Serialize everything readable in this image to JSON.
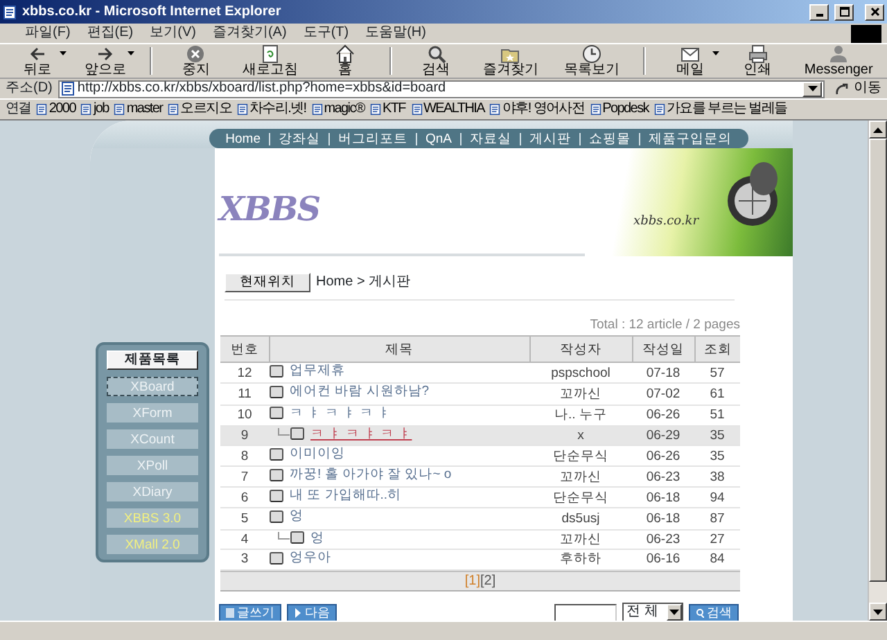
{
  "window": {
    "title": "xbbs.co.kr - Microsoft Internet Explorer"
  },
  "menu_bar": [
    "파일(F)",
    "편집(E)",
    "보기(V)",
    "즐겨찾기(A)",
    "도구(T)",
    "도움말(H)"
  ],
  "toolbar": [
    {
      "kind": "back",
      "label": "뒤로",
      "dropdown": true
    },
    {
      "kind": "forward",
      "label": "앞으로",
      "dropdown": true
    },
    {
      "kind": "stop",
      "label": "중지",
      "dropdown": false
    },
    {
      "kind": "refresh",
      "label": "새로고침",
      "dropdown": false
    },
    {
      "kind": "home",
      "label": "홈",
      "dropdown": false
    },
    {
      "kind": "search",
      "label": "검색",
      "dropdown": false
    },
    {
      "kind": "favorites",
      "label": "즐겨찾기",
      "dropdown": false
    },
    {
      "kind": "history",
      "label": "목록보기",
      "dropdown": false
    },
    {
      "kind": "mail",
      "label": "메일",
      "dropdown": true
    },
    {
      "kind": "print",
      "label": "인쇄",
      "dropdown": false
    },
    {
      "kind": "messenger",
      "label": "Messenger",
      "dropdown": false
    }
  ],
  "address": {
    "label": "주소(D)",
    "value": "http://xbbs.co.kr/xbbs/xboard/list.php?home=xbbs&id=board",
    "go": "이동"
  },
  "links": {
    "label": "연결",
    "items": [
      "2000",
      "job",
      "master",
      "오르지오",
      "차수리.넷!",
      "magic®",
      "KTF",
      "WEALTHIA",
      "야후! 영어사전",
      "Popdesk",
      "가요를 부르는 벌레들"
    ]
  },
  "site": {
    "nav": [
      "Home",
      "강좌실",
      "버그리포트",
      "QnA",
      "자료실",
      "게시판",
      "쇼핑몰",
      "제품구입문의"
    ],
    "logo": "XBBS",
    "banner": "xbbs.co.kr",
    "breadcrumb": {
      "button": "현재위치",
      "path": "Home > 게시판"
    },
    "sidebar": {
      "title": "제품목록",
      "items": [
        {
          "label": "XBoard",
          "featured": false,
          "focused": true
        },
        {
          "label": "XForm",
          "featured": false,
          "focused": false
        },
        {
          "label": "XCount",
          "featured": false,
          "focused": false
        },
        {
          "label": "XPoll",
          "featured": false,
          "focused": false
        },
        {
          "label": "XDiary",
          "featured": false,
          "focused": false
        },
        {
          "label": "XBBS 3.0",
          "featured": true,
          "focused": false
        },
        {
          "label": "XMall 2.0",
          "featured": true,
          "focused": false
        }
      ]
    },
    "total": "Total : 12 article / 2 pages",
    "table": {
      "columns": [
        "번호",
        "제목",
        "작성자",
        "작성일",
        "조회"
      ],
      "rows": [
        {
          "number": "12",
          "title": "업무제휴",
          "author": "pspschool",
          "date": "07-18",
          "views": "57",
          "selected": false
        },
        {
          "number": "11",
          "title": "에어컨 바람 시원하남?",
          "author": "꼬까신",
          "date": "07-02",
          "views": "61",
          "selected": false
        },
        {
          "number": "10",
          "title": "ㅋ ㅑ ㅋ ㅑ ㅋ ㅑ",
          "author": "나.. 누구",
          "date": "06-26",
          "views": "51",
          "selected": false,
          "children": [
            {
              "number": "9",
              "title": "ㅋ ㅑ ㅋ ㅑ ㅋ ㅑ",
              "author": "x",
              "date": "06-29",
              "views": "35",
              "selected": true
            }
          ]
        },
        {
          "number": "8",
          "title": "이미이잉",
          "author": "단순무식",
          "date": "06-26",
          "views": "35",
          "selected": false
        },
        {
          "number": "7",
          "title": "까꿍! 홀 아가야 잘 있나~ o",
          "author": "꼬까신",
          "date": "06-23",
          "views": "38",
          "selected": false
        },
        {
          "number": "6",
          "title": "내 또 가입해따..히",
          "author": "단순무식",
          "date": "06-18",
          "views": "94",
          "selected": false
        },
        {
          "number": "5",
          "title": "엉",
          "author": "ds5usj",
          "date": "06-18",
          "views": "87",
          "selected": false,
          "children": [
            {
              "number": "4",
              "title": "엉",
              "author": "꼬까신",
              "date": "06-23",
              "views": "27",
              "selected": false
            }
          ]
        },
        {
          "number": "3",
          "title": "엉우아",
          "author": "후하하",
          "date": "06-16",
          "views": "84",
          "selected": false
        }
      ]
    },
    "pages": [
      {
        "label": "[1]",
        "selected": true
      },
      {
        "label": "[2]",
        "selected": false
      }
    ],
    "buttons": [
      "글쓰기",
      "다음"
    ],
    "search": {
      "scope": "전 체",
      "button": "검색"
    }
  }
}
